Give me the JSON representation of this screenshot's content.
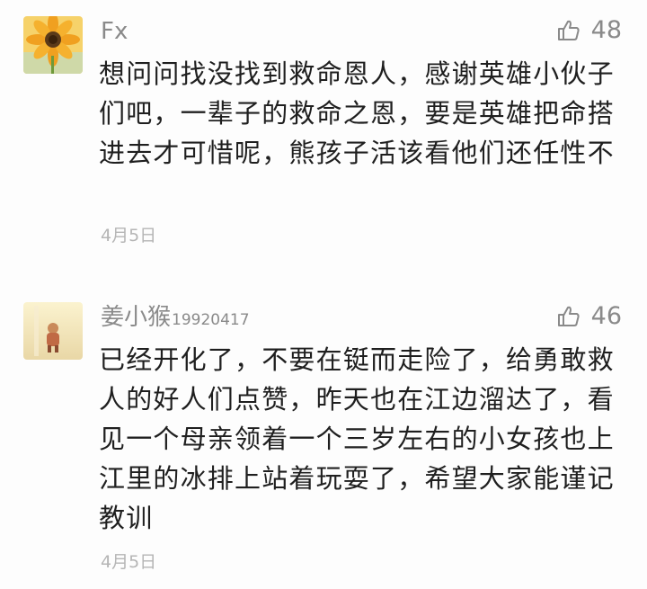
{
  "comments": [
    {
      "username": "Fx",
      "username_suffix": "",
      "likes": "48",
      "text": "想问问找没找到救命恩人，感谢英雄小伙子们吧，一辈子的救命之恩，要是英雄把命搭进去才可惜呢，熊孩子活该看他们还任性不",
      "date": "4月5日",
      "avatar_icon": "sunflower-avatar-icon"
    },
    {
      "username": "姜小猴",
      "username_suffix": "19920417",
      "likes": "46",
      "text": "已经开化了，不要在铤而走险了，给勇敢救人的好人们点赞，昨天也在江边溜达了，看见一个母亲领着一个三岁左右的小女孩也上江里的冰排上站着玩耍了，希望大家能谨记教训",
      "date": "4月5日",
      "avatar_icon": "toddler-avatar-icon"
    }
  ],
  "colors": {
    "meta": "#8a8a8a",
    "text": "#1f1f1f",
    "date": "#b5b5b5",
    "background": "#fdfdfd"
  },
  "icons": {
    "like": "thumbs-up-icon"
  }
}
